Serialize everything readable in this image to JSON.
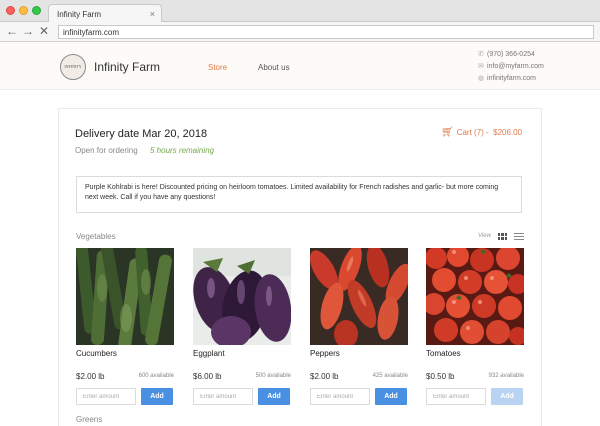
{
  "browser": {
    "tab_title": "Infinity Farm",
    "tab_close": "×",
    "url": "infinityfarm.com",
    "back_glyph": "←",
    "forward_glyph": "→",
    "stop_glyph": "✕"
  },
  "header": {
    "logo_text": "INFINITY",
    "brand": "Infinity Farm",
    "nav": [
      {
        "label": "Store",
        "active": true
      },
      {
        "label": "About us",
        "active": false
      }
    ],
    "contact": {
      "phone": "(970) 366-0254",
      "email": "info@myfarm.com",
      "website": "infinityfarm.com"
    }
  },
  "order": {
    "delivery_title": "Delivery date Mar 20, 2018",
    "status": "Open for ordering",
    "remaining": "5 hours remaining",
    "cart_label": "Cart (7) -",
    "cart_total": "$206.00"
  },
  "notice": "Purple Kohlrabi is here! Discounted pricing on heirloom tomatoes. Limited availability for French radishes and garlic- but more coming next week.  Call if you have any questions!",
  "vegetables": {
    "label": "Vegetables",
    "view_label": "View",
    "products": [
      {
        "name": "Cucumbers",
        "price": "$2.00 lb",
        "available": "600 available",
        "placeholder": "Enter amount",
        "button": "Add",
        "enabled": true
      },
      {
        "name": "Eggplant",
        "price": "$6.00 lb",
        "available": "500 available",
        "placeholder": "Enter amount",
        "button": "Add",
        "enabled": true
      },
      {
        "name": "Peppers",
        "price": "$2.00 lb",
        "available": "425 available",
        "placeholder": "Enter amount",
        "button": "Add",
        "enabled": true
      },
      {
        "name": "Tomatoes",
        "price": "$0.50 lb",
        "available": "932 available",
        "placeholder": "Enter amount",
        "button": "Add",
        "enabled": false
      }
    ]
  },
  "greens": {
    "label": "Greens"
  },
  "colors": {
    "accent_orange": "#e07b4c",
    "accent_green": "#74a84a",
    "button_blue": "#4a90e2",
    "button_blue_disabled": "#b9d4f3"
  }
}
